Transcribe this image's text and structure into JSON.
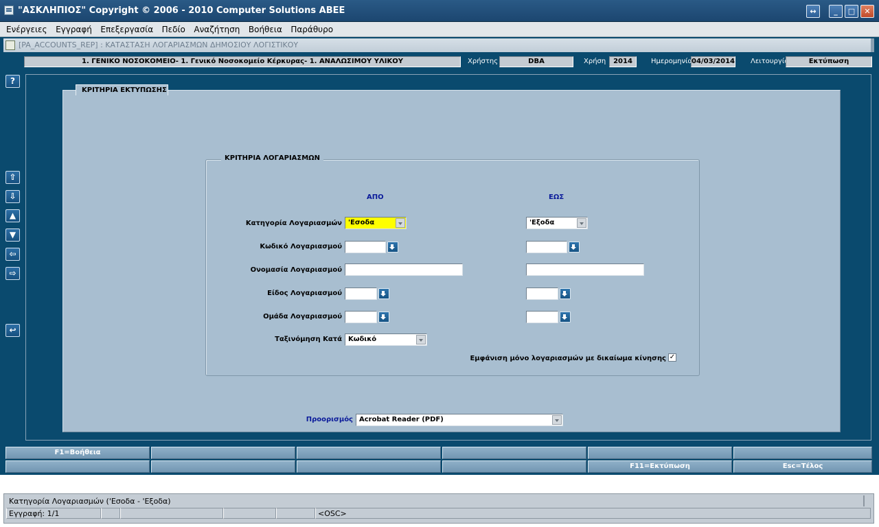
{
  "window": {
    "title": "\"ΑΣΚΛΗΠΙΟΣ\" Copyright © 2006 - 2010 Computer Solutions ΑΒΕΕ",
    "buttons": {
      "restore": "↔",
      "minimize": "_",
      "maximize": "□",
      "close": "✕"
    }
  },
  "menu": [
    "Ενέργειες",
    "Εγγραφή",
    "Επεξεργασία",
    "Πεδίο",
    "Αναζήτηση",
    "Βοήθεια",
    "Παράθυρο"
  ],
  "form": {
    "title": "[PA_ACCOUNTS_REP]  :  ΚΑΤΑΣΤΑΣΗ ΛΟΓΑΡΙΑΣΜΩΝ ΔΗΜΟΣΙΟΥ ΛΟΓΙΣΤΙΚΟΥ"
  },
  "header": {
    "hospital": "1. ΓΕΝΙΚΟ ΝΟΣΟΚΟΜΕΙΟ- 1. Γενικό Νοσοκομείο Κέρκυρας- 1. ΑΝΑΛΩΣΙΜΟΥ ΥΛΙΚΟΥ",
    "user_label": "Χρήστης",
    "user": "DBA",
    "year_label": "Χρήση",
    "year": "2014",
    "date_label": "Ημερομηνία",
    "date": "04/03/2014",
    "mode_label": "Λειτουργία",
    "mode": "Εκτύπωση"
  },
  "toolbar": {
    "help": "?",
    "first": "⇧",
    "last": "⇩",
    "prev": "▲",
    "next": "▼",
    "left": "⇦",
    "right": "⇨",
    "back": "↩"
  },
  "tab": {
    "label": "ΚΡΙΤΗΡΙΑ ΕΚΤΥΠΩΣΗΣ"
  },
  "criteria": {
    "group_title": "ΚΡΙΤΗΡΙΑ ΛΟΓΑΡΙΑΣΜΩΝ",
    "from_header": "ΑΠΟ",
    "to_header": "ΕΩΣ",
    "category_label": "Κατηγορία Λογαριασμών",
    "category_from": "'Εσοδα",
    "category_to": "'Εξοδα",
    "code_label": "Κωδικό Λογαριασμού",
    "code_from": "",
    "code_to": "",
    "name_label": "Ονομασία Λογαριασμού",
    "name_from": "",
    "name_to": "",
    "type_label": "Είδος Λογαριασμού",
    "type_from": "",
    "type_to": "",
    "group_label": "Ομάδα Λογαριασμού",
    "group_from": "",
    "group_to": "",
    "sort_label": "Ταξινόμηση Κατά",
    "sort_value": "Κωδικό",
    "show_only_label": "Εμφάνιση μόνο λογαριασμών με δικαίωμα κίνησης",
    "show_only_checked": "✓"
  },
  "destination": {
    "label": "Προορισμός",
    "value": "Acrobat Reader (PDF)"
  },
  "fkeys": {
    "row1": [
      "F1=Βοήθεια",
      "",
      "",
      "",
      "",
      ""
    ],
    "row2": [
      "",
      "",
      "",
      "",
      "F11=Εκτύπωση",
      "Esc=Τέλος"
    ]
  },
  "status": {
    "message": "Κατηγορία Λογαριασμών ('Εσοδα - 'Εξοδα)",
    "record": "Εγγραφή: 1/1",
    "mode": "<OSC>"
  },
  "colors": {
    "background": "#0a4a6e",
    "panel": "#a8bed0",
    "highlight_field": "#ffff00",
    "column_header": "#0a1a9a"
  }
}
